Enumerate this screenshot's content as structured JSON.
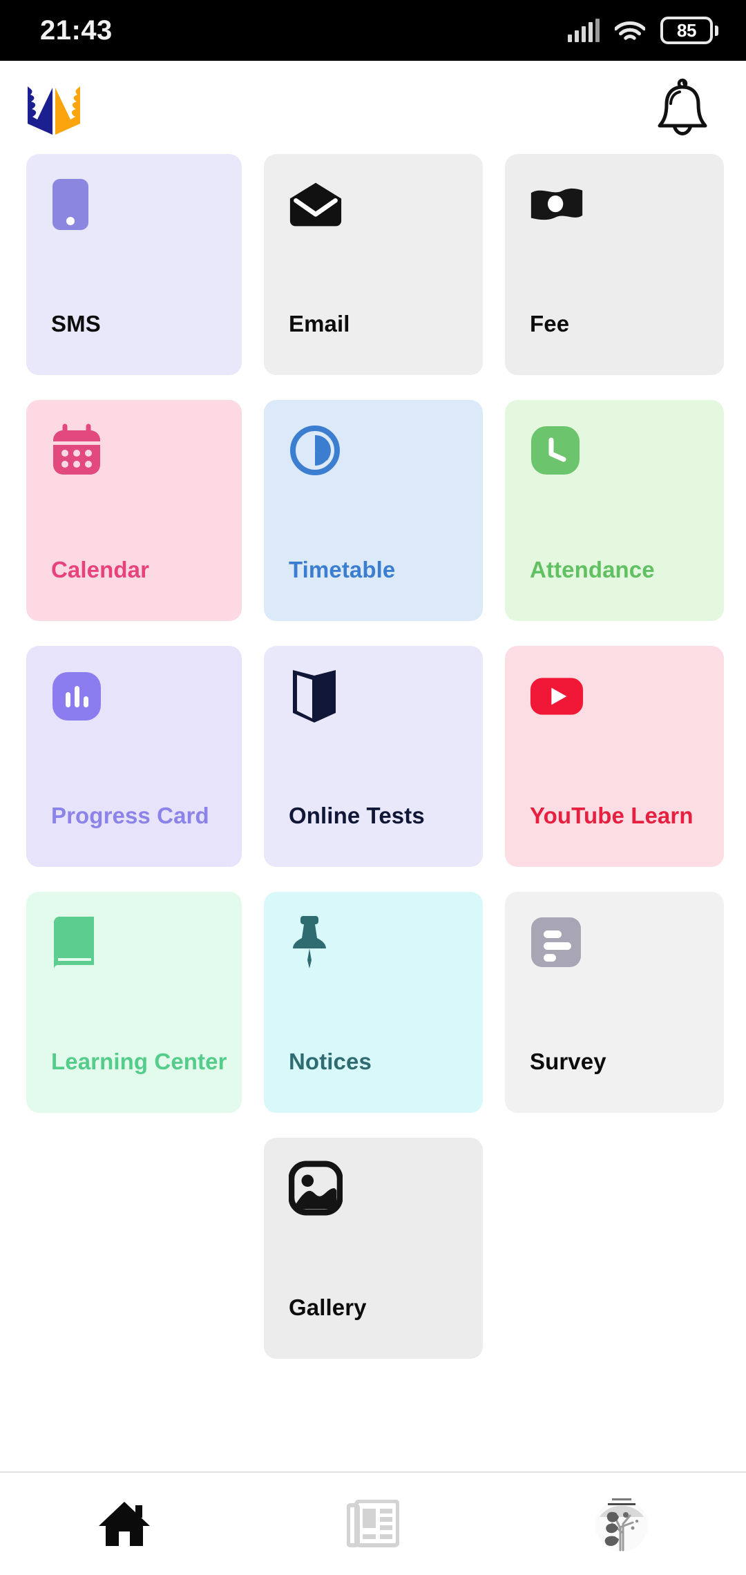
{
  "status_bar": {
    "time": "21:43",
    "battery_level": "85",
    "icons": [
      "signal-icon",
      "wifi-icon",
      "battery-icon"
    ]
  },
  "header": {
    "logo_name": "open-book-logo",
    "logo_colors": {
      "left_page": "#1b1f8f",
      "right_page": "#fba40e"
    },
    "notification_icon": "bell-icon"
  },
  "grid": {
    "tiles": [
      {
        "label": "SMS",
        "icon": "phone-icon",
        "bg": "#e9e8fb",
        "icon_color": "#8b87e0",
        "text_color": "#0c0c0c"
      },
      {
        "label": "Email",
        "icon": "envelope-open-icon",
        "bg": "#eeeeee",
        "icon_color": "#111111",
        "text_color": "#0c0c0c"
      },
      {
        "label": "Fee",
        "icon": "banknote-icon",
        "bg": "#ededed",
        "icon_color": "#161616",
        "text_color": "#0c0c0c"
      },
      {
        "label": "Calendar",
        "icon": "calendar-icon",
        "bg": "#fcd9e3",
        "icon_color": "#e24a7f",
        "text_color": "#e8427d"
      },
      {
        "label": "Timetable",
        "icon": "clock-pie-icon",
        "bg": "#dce9f9",
        "icon_color": "#3b7ed0",
        "text_color": "#3b7ed0"
      },
      {
        "label": "Attendance",
        "icon": "clock-square-icon",
        "bg": "#e4f8e0",
        "icon_color": "#6cc46c",
        "text_color": "#61c061"
      },
      {
        "label": "Progress Card",
        "icon": "bar-chart-icon",
        "bg": "#e6e3fa",
        "icon_color": "#8b7df0",
        "text_color": "#8b82ea"
      },
      {
        "label": "Online Tests",
        "icon": "open-book-icon",
        "bg": "#e9e8fb",
        "icon_color": "#101636",
        "text_color": "#101636"
      },
      {
        "label": "YouTube Learn",
        "icon": "youtube-play-icon",
        "bg": "#fcdde4",
        "icon_color": "#f01836",
        "text_color": "#e8203f"
      },
      {
        "label": "Learning Center",
        "icon": "book-icon",
        "bg": "#e3fbec",
        "icon_color": "#5ccd8e",
        "text_color": "#54cc8a"
      },
      {
        "label": "Notices",
        "icon": "pushpin-icon",
        "bg": "#d9f8fa",
        "icon_color": "#2f6c72",
        "text_color": "#2f6c72"
      },
      {
        "label": "Survey",
        "icon": "poll-icon",
        "bg": "#f1f1f1",
        "icon_color": "#a8a6b4",
        "text_color": "#0c0c0c"
      },
      {
        "label": "Gallery",
        "icon": "image-icon",
        "bg": "#ececec",
        "icon_color": "#141414",
        "text_color": "#0c0c0c"
      }
    ]
  },
  "bottom_nav": {
    "items": [
      {
        "icon": "home-icon",
        "active": true
      },
      {
        "icon": "newspaper-icon",
        "active": false
      },
      {
        "icon": "tree-icon",
        "active": false
      }
    ]
  }
}
